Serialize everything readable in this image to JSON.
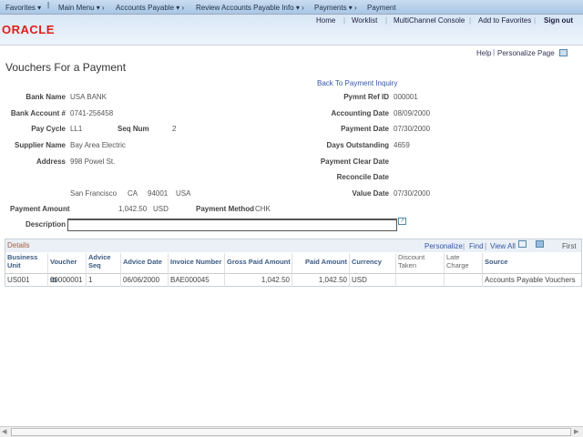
{
  "nav": {
    "favorites": "Favorites",
    "main_menu": "Main Menu",
    "crumbs": [
      "Accounts Payable",
      "Review Accounts Payable Info",
      "Payments",
      "Payment"
    ]
  },
  "header": {
    "links": [
      "Home",
      "Worklist",
      "MultiChannel Console",
      "Add to Favorites"
    ],
    "signout": "Sign out",
    "logo": "ORACLE"
  },
  "toolbar": {
    "help": "Help",
    "personalize": "Personalize Page"
  },
  "page": {
    "title": "Vouchers For a Payment",
    "back_link": "Back To Payment Inquiry"
  },
  "left": {
    "bank_name": {
      "label": "Bank Name",
      "value": "USA BANK"
    },
    "bank_account": {
      "label": "Bank Account #",
      "value": "0741-256458"
    },
    "pay_cycle": {
      "label": "Pay Cycle",
      "value": "LL1"
    },
    "seq_num": {
      "label": "Seq Num",
      "value": "2"
    },
    "supplier": {
      "label": "Supplier Name",
      "value": "Bay Area Electric"
    },
    "address": {
      "label": "Address",
      "value": "998 Powel St.",
      "city": "San Francisco",
      "state": "CA",
      "zip": "94001",
      "country": "USA"
    },
    "payment_amount": {
      "label": "Payment Amount",
      "value": "1,042.50",
      "currency": "USD"
    },
    "payment_method": {
      "label": "Payment Method",
      "value": "CHK"
    },
    "description": {
      "label": "Description",
      "value": ""
    }
  },
  "right": {
    "ref_id": {
      "label": "Pymnt Ref ID",
      "value": "000001"
    },
    "acct_date": {
      "label": "Accounting Date",
      "value": "08/09/2000"
    },
    "pay_date": {
      "label": "Payment Date",
      "value": "07/30/2000"
    },
    "days_out": {
      "label": "Days Outstanding",
      "value": "4659"
    },
    "clear_date": {
      "label": "Payment Clear Date",
      "value": ""
    },
    "reconcile": {
      "label": "Reconcile Date",
      "value": ""
    },
    "value_date": {
      "label": "Value Date",
      "value": "07/30/2000"
    }
  },
  "grid": {
    "title": "Details",
    "personalize": "Personalize",
    "find": "Find",
    "view_all": "View All",
    "first": "First",
    "columns": [
      "Business Unit",
      "Voucher ID",
      "Advice Seq",
      "Advice Date",
      "Invoice Number",
      "Gross Paid Amount",
      "Paid Amount",
      "Currency",
      "Discount Taken",
      "Late Charge",
      "Source"
    ],
    "rows": [
      [
        "US001",
        "00000001",
        "1",
        "06/06/2000",
        "BAE000045",
        "1,042.50",
        "1,042.50",
        "USD",
        "",
        "",
        "Accounts Payable Vouchers"
      ]
    ]
  }
}
